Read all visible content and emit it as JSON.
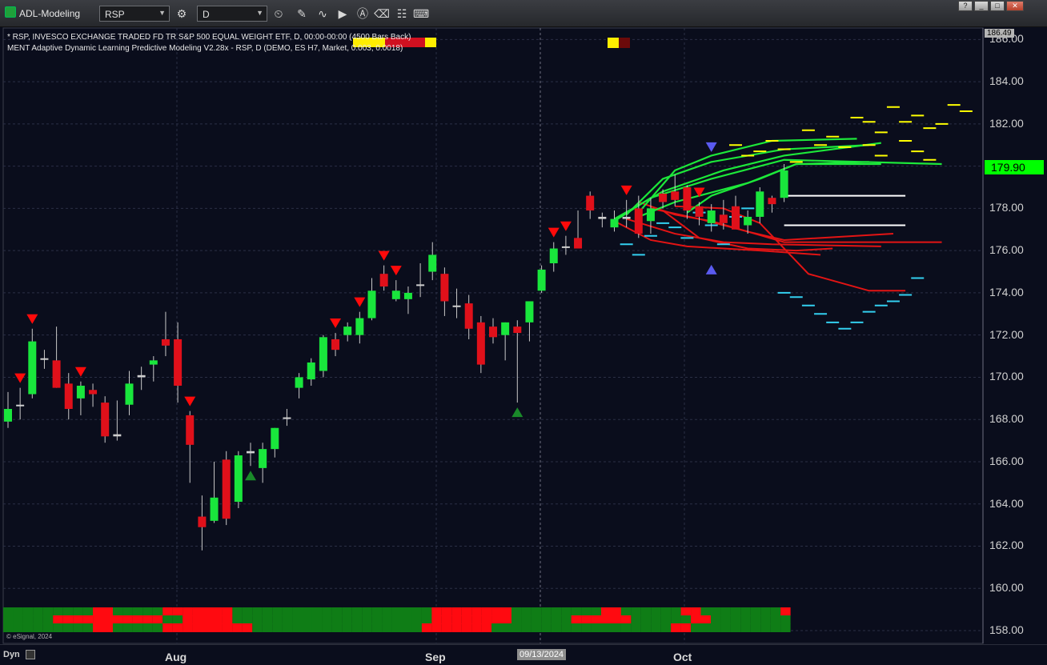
{
  "window": {
    "title": "ADL-Modeling",
    "symbol": "RSP",
    "interval": "D",
    "controls": [
      "?",
      "_",
      "□",
      "✕"
    ]
  },
  "legend": {
    "line1": "* RSP, INVESCO EXCHANGE TRADED FD TR S&P 500 EQUAL WEIGHT ETF, D, 00:00-00:00 (4500 Bars Back)",
    "line2": "MENT Adaptive Dynamic Learning Predictive Modeling V2.28x - RSP, D (DEMO, ES H7, Market, 0.003, 0.0018)"
  },
  "price_axis": {
    "top_price": "186.49",
    "last_price": "179.90"
  },
  "x_axis": {
    "cursor_date": "09/13/2024",
    "dyn_label": "Dyn"
  },
  "copyright": "© eSignal, 2024",
  "colors": {
    "background": "#0a0d1c",
    "bull": "#19e63c",
    "bear": "#e0101a",
    "model_green": "#1de83a",
    "model_red": "#e31414",
    "yellow": "#ffff00",
    "cyan": "#33d0f0",
    "white": "#ffffff",
    "sell_arrow": "#ff0a0a",
    "buy_arrow": "#1a8a2a",
    "blue_arrow": "#5a5af0"
  },
  "chart_data": {
    "type": "candlestick",
    "yticks": [
      "158.00",
      "160.00",
      "162.00",
      "164.00",
      "166.00",
      "168.00",
      "170.00",
      "172.00",
      "174.00",
      "176.00",
      "178.00",
      "180.00",
      "182.00",
      "184.00",
      "186.00"
    ],
    "ylim": [
      157.5,
      186.5
    ],
    "xticks": [
      "Aug",
      "Sep",
      "Oct"
    ],
    "candles": [
      {
        "o": 167.9,
        "h": 169.3,
        "l": 167.6,
        "c": 168.5
      },
      {
        "o": 168.7,
        "h": 169.5,
        "l": 168.0,
        "c": 168.7
      },
      {
        "o": 169.2,
        "h": 172.3,
        "l": 169.0,
        "c": 171.7
      },
      {
        "o": 170.9,
        "h": 171.3,
        "l": 170.4,
        "c": 170.9
      },
      {
        "o": 170.8,
        "h": 172.4,
        "l": 169.5,
        "c": 169.5
      },
      {
        "o": 169.7,
        "h": 170.2,
        "l": 168.0,
        "c": 168.5
      },
      {
        "o": 169.0,
        "h": 169.8,
        "l": 168.2,
        "c": 169.6
      },
      {
        "o": 169.4,
        "h": 169.7,
        "l": 168.6,
        "c": 169.2
      },
      {
        "o": 168.8,
        "h": 169.1,
        "l": 166.9,
        "c": 167.2
      },
      {
        "o": 167.2,
        "h": 168.9,
        "l": 167.0,
        "c": 167.3
      },
      {
        "o": 168.7,
        "h": 170.3,
        "l": 168.2,
        "c": 169.7
      },
      {
        "o": 170.1,
        "h": 170.5,
        "l": 169.4,
        "c": 170.0
      },
      {
        "o": 170.6,
        "h": 171.0,
        "l": 169.8,
        "c": 170.8
      },
      {
        "o": 171.8,
        "h": 173.1,
        "l": 171.0,
        "c": 171.5
      },
      {
        "o": 171.8,
        "h": 172.6,
        "l": 168.8,
        "c": 169.6
      },
      {
        "o": 168.2,
        "h": 168.4,
        "l": 165.0,
        "c": 166.8
      },
      {
        "o": 163.4,
        "h": 164.4,
        "l": 161.8,
        "c": 162.9
      },
      {
        "o": 163.2,
        "h": 166.0,
        "l": 163.1,
        "c": 164.3
      },
      {
        "o": 166.1,
        "h": 166.5,
        "l": 163.0,
        "c": 163.3
      },
      {
        "o": 164.1,
        "h": 166.5,
        "l": 163.8,
        "c": 166.3
      },
      {
        "o": 166.4,
        "h": 166.9,
        "l": 165.8,
        "c": 166.5
      },
      {
        "o": 165.7,
        "h": 166.9,
        "l": 165.0,
        "c": 166.6
      },
      {
        "o": 166.6,
        "h": 167.6,
        "l": 166.2,
        "c": 167.6
      },
      {
        "o": 168.1,
        "h": 168.5,
        "l": 167.7,
        "c": 168.1
      },
      {
        "o": 169.5,
        "h": 170.2,
        "l": 169.0,
        "c": 170.0
      },
      {
        "o": 169.9,
        "h": 170.9,
        "l": 169.6,
        "c": 170.7
      },
      {
        "o": 170.3,
        "h": 172.0,
        "l": 170.0,
        "c": 171.9
      },
      {
        "o": 171.8,
        "h": 172.1,
        "l": 171.0,
        "c": 171.3
      },
      {
        "o": 172.0,
        "h": 172.6,
        "l": 171.7,
        "c": 172.4
      },
      {
        "o": 172.0,
        "h": 173.1,
        "l": 171.6,
        "c": 172.8
      },
      {
        "o": 172.8,
        "h": 174.7,
        "l": 172.7,
        "c": 174.1
      },
      {
        "o": 174.9,
        "h": 175.3,
        "l": 174.1,
        "c": 174.3
      },
      {
        "o": 173.7,
        "h": 174.6,
        "l": 173.6,
        "c": 174.1
      },
      {
        "o": 173.7,
        "h": 174.3,
        "l": 173.0,
        "c": 174.0
      },
      {
        "o": 174.4,
        "h": 175.4,
        "l": 173.8,
        "c": 174.4
      },
      {
        "o": 175.0,
        "h": 176.4,
        "l": 174.6,
        "c": 175.8
      },
      {
        "o": 174.9,
        "h": 175.2,
        "l": 172.9,
        "c": 173.6
      },
      {
        "o": 173.4,
        "h": 174.2,
        "l": 172.8,
        "c": 173.4
      },
      {
        "o": 173.5,
        "h": 173.9,
        "l": 171.8,
        "c": 172.3
      },
      {
        "o": 172.6,
        "h": 172.9,
        "l": 170.2,
        "c": 170.6
      },
      {
        "o": 172.4,
        "h": 172.8,
        "l": 171.6,
        "c": 171.9
      },
      {
        "o": 172.0,
        "h": 172.6,
        "l": 170.8,
        "c": 172.6
      },
      {
        "o": 172.4,
        "h": 172.7,
        "l": 168.8,
        "c": 172.1
      },
      {
        "o": 172.6,
        "h": 173.2,
        "l": 171.7,
        "c": 173.6
      },
      {
        "o": 174.1,
        "h": 175.3,
        "l": 174.0,
        "c": 175.1
      },
      {
        "o": 175.4,
        "h": 176.4,
        "l": 175.0,
        "c": 176.1
      },
      {
        "o": 176.2,
        "h": 176.7,
        "l": 175.8,
        "c": 176.2
      },
      {
        "o": 176.6,
        "h": 177.9,
        "l": 176.2,
        "c": 176.1
      },
      {
        "o": 178.6,
        "h": 178.8,
        "l": 177.5,
        "c": 177.9
      },
      {
        "o": 177.6,
        "h": 177.8,
        "l": 177.1,
        "c": 177.5
      },
      {
        "o": 177.1,
        "h": 177.9,
        "l": 176.9,
        "c": 177.5
      },
      {
        "o": 177.5,
        "h": 178.4,
        "l": 177.1,
        "c": 177.6
      },
      {
        "o": 178.0,
        "h": 178.6,
        "l": 176.6,
        "c": 176.8
      },
      {
        "o": 177.4,
        "h": 178.5,
        "l": 176.8,
        "c": 178.0
      },
      {
        "o": 178.7,
        "h": 178.9,
        "l": 178.0,
        "c": 178.3
      },
      {
        "o": 178.8,
        "h": 179.6,
        "l": 178.1,
        "c": 178.4
      },
      {
        "o": 179.0,
        "h": 179.1,
        "l": 177.5,
        "c": 177.9
      },
      {
        "o": 178.1,
        "h": 178.3,
        "l": 177.2,
        "c": 177.6
      },
      {
        "o": 177.3,
        "h": 178.2,
        "l": 176.9,
        "c": 177.9
      },
      {
        "o": 177.7,
        "h": 178.4,
        "l": 177.0,
        "c": 177.3
      },
      {
        "o": 178.1,
        "h": 178.6,
        "l": 177.1,
        "c": 177.0
      },
      {
        "o": 177.2,
        "h": 177.9,
        "l": 176.8,
        "c": 177.6
      },
      {
        "o": 177.6,
        "h": 179.0,
        "l": 177.3,
        "c": 178.8
      },
      {
        "o": 178.5,
        "h": 178.6,
        "l": 177.8,
        "c": 178.2
      },
      {
        "o": 178.5,
        "h": 180.1,
        "l": 178.3,
        "c": 179.8
      }
    ],
    "sell_signals": [
      1,
      2,
      6,
      15,
      27,
      29,
      31,
      32,
      45,
      46,
      51,
      57
    ],
    "buy_signals": [
      20,
      42
    ],
    "blue_markers": [
      {
        "index": 58,
        "dir": "down",
        "price": 180.9
      },
      {
        "index": 58,
        "dir": "up",
        "price": 175.1
      }
    ],
    "forecast_green": [
      [
        [
          52,
          177.8
        ],
        [
          55,
          179.8
        ],
        [
          58,
          180.5
        ],
        [
          63,
          181.2
        ],
        [
          70,
          181.3
        ]
      ],
      [
        [
          51,
          177.7
        ],
        [
          54,
          179.4
        ],
        [
          58,
          180.2
        ],
        [
          64,
          180.8
        ],
        [
          71,
          181.0
        ]
      ],
      [
        [
          50,
          177.5
        ],
        [
          54,
          178.8
        ],
        [
          59,
          179.8
        ],
        [
          64,
          180.5
        ],
        [
          72,
          181.1
        ]
      ],
      [
        [
          50,
          177.4
        ],
        [
          53,
          178.5
        ],
        [
          58,
          179.4
        ],
        [
          64,
          180.3
        ],
        [
          77,
          180.1
        ]
      ],
      [
        [
          52,
          177.6
        ],
        [
          55,
          178.3
        ],
        [
          61,
          179.2
        ],
        [
          65,
          180.1
        ],
        [
          72,
          180.1
        ]
      ],
      [
        [
          56,
          177.8
        ],
        [
          58,
          178.6
        ],
        [
          62,
          179.4
        ],
        [
          65,
          180.1
        ],
        [
          71,
          180.2
        ]
      ]
    ],
    "forecast_red": [
      [
        [
          52,
          178.3
        ],
        [
          55,
          177.7
        ],
        [
          58,
          177.4
        ],
        [
          61,
          176.9
        ],
        [
          64,
          176.4
        ],
        [
          77,
          176.4
        ]
      ],
      [
        [
          50,
          177.4
        ],
        [
          53,
          176.5
        ],
        [
          56,
          176.2
        ],
        [
          62,
          176.0
        ],
        [
          67,
          175.8
        ]
      ],
      [
        [
          51,
          177.5
        ],
        [
          55,
          176.8
        ],
        [
          59,
          176.4
        ],
        [
          63,
          176.3
        ],
        [
          72,
          176.2
        ]
      ],
      [
        [
          53,
          178.0
        ],
        [
          57,
          177.5
        ],
        [
          61,
          176.9
        ],
        [
          64,
          176.5
        ],
        [
          73,
          176.8
        ]
      ],
      [
        [
          55,
          178.1
        ],
        [
          59,
          178.0
        ],
        [
          62,
          177.3
        ],
        [
          66,
          174.9
        ],
        [
          71,
          174.1
        ],
        [
          74,
          174.1
        ]
      ],
      [
        [
          54,
          177.9
        ],
        [
          57,
          176.6
        ],
        [
          61,
          176.1
        ],
        [
          65,
          176.0
        ],
        [
          68,
          176.1
        ]
      ]
    ],
    "forecast_white": [
      [
        64,
        178.6,
        74
      ],
      [
        64,
        177.2,
        74
      ]
    ],
    "yellow_dashes": [
      [
        60,
        181.0
      ],
      [
        61,
        180.5
      ],
      [
        62,
        180.7
      ],
      [
        63,
        181.2
      ],
      [
        64,
        180.8
      ],
      [
        65,
        180.2
      ],
      [
        66,
        181.7
      ],
      [
        67,
        181.0
      ],
      [
        68,
        181.4
      ],
      [
        69,
        180.9
      ],
      [
        70,
        182.3
      ],
      [
        71,
        182.1
      ],
      [
        72,
        181.6
      ],
      [
        73,
        182.8
      ],
      [
        74,
        182.1
      ],
      [
        75,
        182.4
      ],
      [
        76,
        181.8
      ],
      [
        77,
        182.0
      ],
      [
        78,
        182.9
      ],
      [
        79,
        182.6
      ],
      [
        71,
        181.0
      ],
      [
        72,
        180.5
      ],
      [
        74,
        181.2
      ],
      [
        75,
        180.7
      ],
      [
        76,
        180.3
      ]
    ],
    "cyan_dashes": [
      [
        51,
        176.3
      ],
      [
        52,
        175.8
      ],
      [
        53,
        176.7
      ],
      [
        54,
        177.3
      ],
      [
        55,
        177.1
      ],
      [
        56,
        176.6
      ],
      [
        57,
        177.8
      ],
      [
        58,
        177.2
      ],
      [
        59,
        176.3
      ],
      [
        60,
        177.6
      ],
      [
        61,
        178.0
      ],
      [
        64,
        174.0
      ],
      [
        65,
        173.8
      ],
      [
        66,
        173.4
      ],
      [
        67,
        173.0
      ],
      [
        68,
        172.6
      ],
      [
        69,
        172.3
      ],
      [
        70,
        172.6
      ],
      [
        71,
        173.1
      ],
      [
        72,
        173.4
      ],
      [
        73,
        173.6
      ],
      [
        74,
        173.9
      ],
      [
        75,
        174.7
      ]
    ],
    "signal_rows": {
      "top": "GGGGGGGGGRRGGGGGRRRRRRRGGGGGGGGGGGGGGGGGGGGRRRRRRRRGGGGGGGGGRRGGGGGGRRGGGGGGGGR",
      "middle": "GGGGGRRRRRRRRRRRGGRRRRRGGGGGGGGGGGGGGGGGGGGRRRRRRRRGGGGGGRRRRRRGGGGGGRRGGGGGGGG",
      "bottom": "GGGGGGGGGRRGGGGGRRRRRRRRRGGGGGGGGGGGGGGGGGRRRRRRRGGGGGGGGGGGGGGGGGGRRGGGGGGGGGG"
    }
  }
}
